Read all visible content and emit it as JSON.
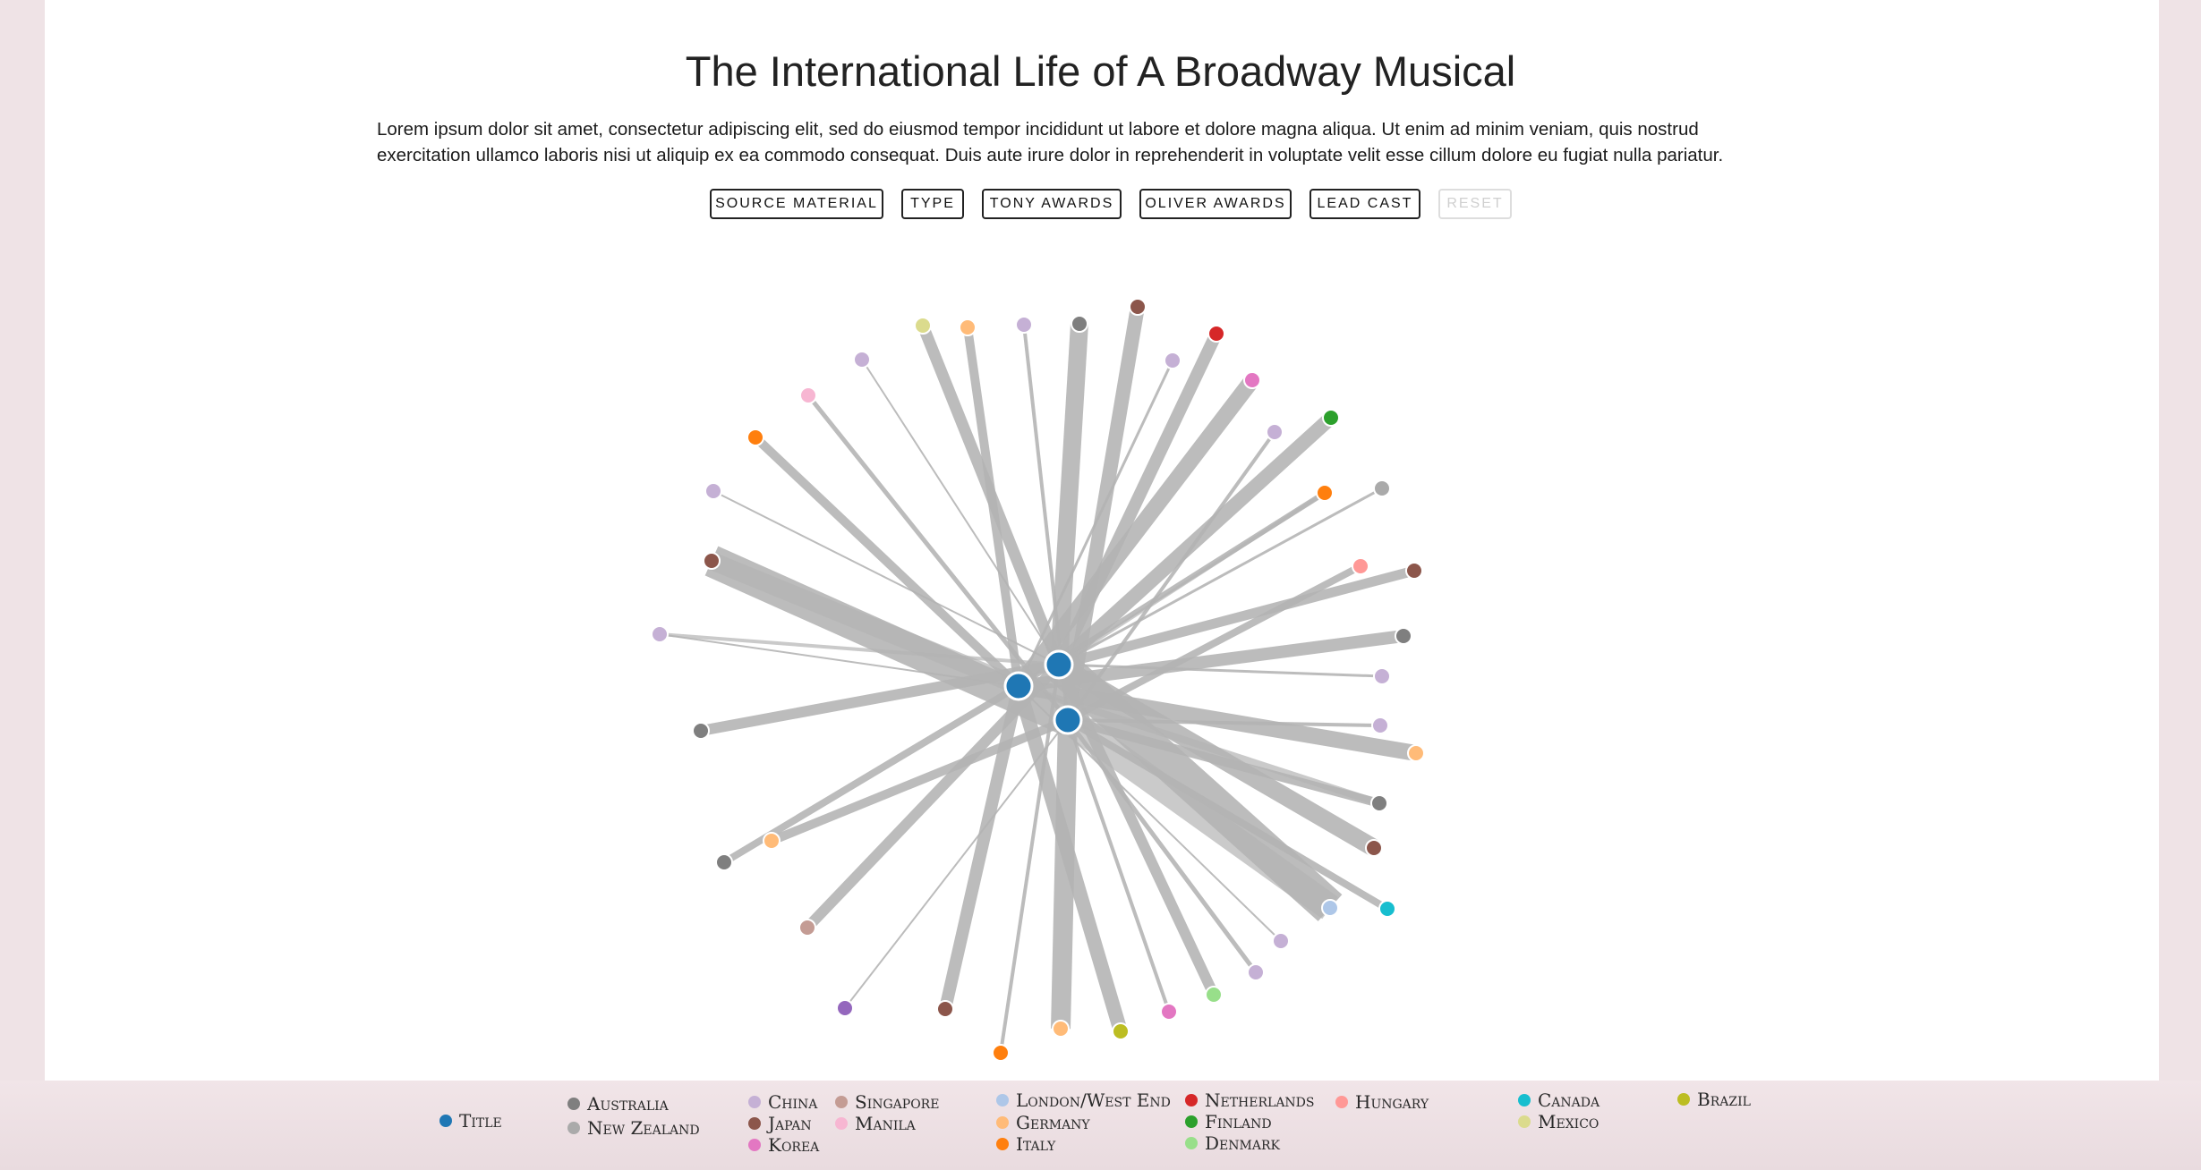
{
  "header": {
    "title": "The International Life of A Broadway Musical",
    "description": "Lorem ipsum dolor sit amet, consectetur adipiscing elit, sed do eiusmod tempor incididunt ut labore et dolore magna aliqua. Ut enim ad minim veniam, quis nostrud exercitation ullamco laboris nisi ut aliquip ex ea commodo consequat. Duis aute irure dolor in reprehenderit in voluptate velit esse cillum dolore eu fugiat nulla pariatur."
  },
  "filters": {
    "source_material": "SOURCE MATERIAL",
    "type": "TYPE",
    "tony_awards": "TONY AWARDS",
    "oliver_awards": "OLIVER AWARDS",
    "lead_cast": "LEAD CAST",
    "reset": "RESET"
  },
  "legend": {
    "title": "Title",
    "australia": "Australia",
    "new_zealand": "New Zealand",
    "china": "China",
    "japan": "Japan",
    "korea": "Korea",
    "singapore": "Singapore",
    "manila": "Manila",
    "london": "London/West End",
    "germany": "Germany",
    "italy": "Italy",
    "netherlands": "Netherlands",
    "finland": "Finland",
    "denmark": "Denmark",
    "hungary": "Hungary",
    "canada": "Canada",
    "mexico": "Mexico",
    "brazil": "Brazil"
  },
  "colors": {
    "title": "#1f77b4",
    "australia": "#7f7f7f",
    "new_zealand": "#aaaaaa",
    "china": "#c5b0d5",
    "japan": "#8c564b",
    "korea": "#e377c2",
    "singapore": "#c49c94",
    "manila": "#f7b6d2",
    "london": "#aec7e8",
    "germany": "#ffbb78",
    "italy": "#ff7f0e",
    "netherlands": "#d62728",
    "finland": "#2ca02c",
    "denmark": "#98df8a",
    "hungary": "#ff9896",
    "canada": "#17becf",
    "mexico": "#dbdb8d",
    "brazil": "#bcbd22",
    "purple": "#9467bd",
    "link": "#b3b3b3"
  }
}
